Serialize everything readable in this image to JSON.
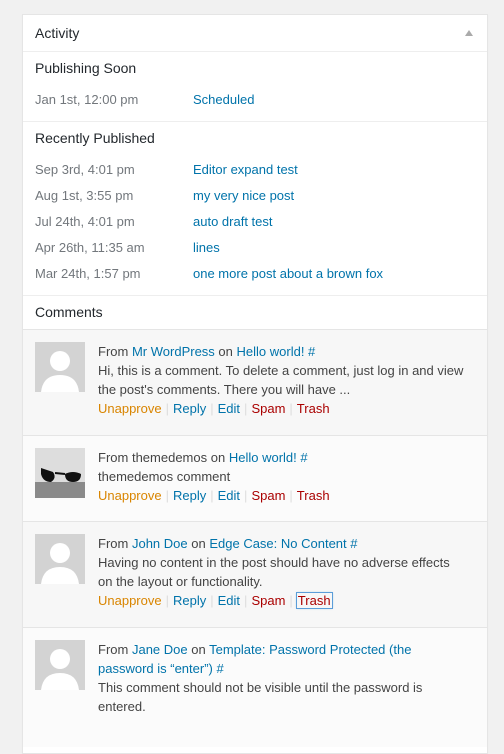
{
  "header": {
    "title": "Activity"
  },
  "publishing_soon": {
    "title": "Publishing Soon",
    "items": [
      {
        "date": "Jan 1st, 12:00 pm",
        "label": "Scheduled"
      }
    ]
  },
  "recently_published": {
    "title": "Recently Published",
    "items": [
      {
        "date": "Sep 3rd, 4:01 pm",
        "label": "Editor expand test"
      },
      {
        "date": "Aug 1st, 3:55 pm",
        "label": "my very nice post"
      },
      {
        "date": "Jul 24th, 4:01 pm",
        "label": "auto draft test"
      },
      {
        "date": "Apr 26th, 11:35 am",
        "label": "lines"
      },
      {
        "date": "Mar 24th, 1:57 pm",
        "label": "one more post about a brown fox"
      }
    ]
  },
  "comments": {
    "title": "Comments",
    "from_label": "From",
    "on_label": "on",
    "actions": {
      "unapprove": "Unapprove",
      "reply": "Reply",
      "edit": "Edit",
      "spam": "Spam",
      "trash": "Trash"
    },
    "items": [
      {
        "author": "Mr WordPress",
        "post": "Hello world! #",
        "text_line1": "Hi, this is a comment. To delete a comment, just log in and view",
        "text_line2": "the post's comments. There you will have ..."
      },
      {
        "author": "themedemos",
        "post": "Hello world! #",
        "text_line1": "themedemos comment"
      },
      {
        "author": "John Doe",
        "post": "Edge Case: No Content #",
        "text_line1": "Having no content in the post should have no adverse effects",
        "text_line2": "on the layout or functionality."
      },
      {
        "author": "Jane Doe",
        "post_line1": "Template: Password Protected (the",
        "post_line2": "password is “enter”) #",
        "text_line1": "This comment should not be visible until the password is",
        "text_line2": "entered."
      }
    ]
  }
}
